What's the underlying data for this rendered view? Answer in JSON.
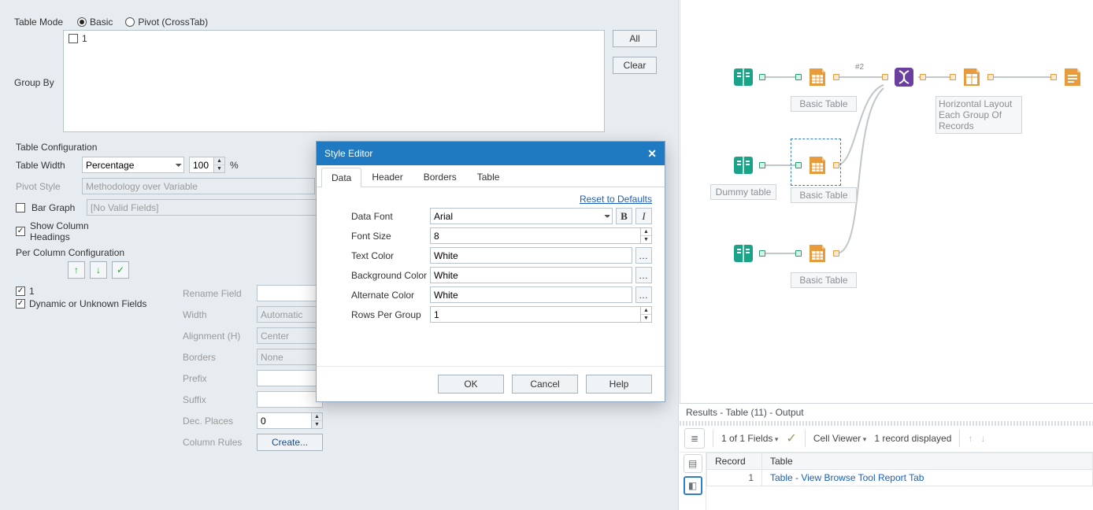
{
  "left": {
    "tableMode": {
      "label": "Table Mode",
      "basic": "Basic",
      "pivot": "Pivot (CrossTab)",
      "selected": "basic"
    },
    "groupBy": {
      "label": "Group By",
      "items": [
        "1"
      ]
    },
    "btn_all": "All",
    "btn_clear": "Clear",
    "sections": {
      "tc": "Table Configuration",
      "pcc": "Per Column Configuration"
    },
    "tc": {
      "tableWidth_lbl": "Table Width",
      "tableWidth_sel": "Percentage",
      "tableWidth_val": "100",
      "tableWidth_unit": "%",
      "pivotStyle_lbl": "Pivot Style",
      "pivotStyle_val": "Methodology over Variable",
      "barGraph_lbl": "Bar Graph",
      "barGraph_val": "[No Valid Fields]",
      "showHeadings_lbl": "Show Column Headings"
    },
    "pcc": {
      "list": [
        "1",
        "Dynamic or Unknown Fields"
      ],
      "rename_lbl": "Rename Field",
      "width_lbl": "Width",
      "width_val": "Automatic",
      "align_lbl": "Alignment (H)",
      "align_val": "Center",
      "borders_lbl": "Borders",
      "borders_val": "None",
      "prefix_lbl": "Prefix",
      "suffix_lbl": "Suffix",
      "dec_lbl": "Dec. Places",
      "dec_val": "0",
      "rules_lbl": "Column Rules",
      "create_btn": "Create..."
    }
  },
  "dialog": {
    "title": "Style Editor",
    "tabs": [
      "Data",
      "Header",
      "Borders",
      "Table"
    ],
    "active_tab": 0,
    "reset": "Reset to Defaults",
    "rows": {
      "dataFont_lbl": "Data Font",
      "dataFont_val": "Arial",
      "fontSize_lbl": "Font Size",
      "fontSize_val": "8",
      "textColor_lbl": "Text Color",
      "textColor_val": "White",
      "bgColor_lbl": "Background Color",
      "bgColor_val": "White",
      "altColor_lbl": "Alternate Color",
      "altColor_val": "White",
      "rowsPer_lbl": "Rows Per Group",
      "rowsPer_val": "1"
    },
    "buttons": {
      "ok": "OK",
      "cancel": "Cancel",
      "help": "Help"
    }
  },
  "canvas": {
    "nodes": {
      "a1_label": "Basic Table",
      "b1_label": "Horizontal Layout Each Group Of Records",
      "a2_inlabel": "Dummy table",
      "a2_label": "Basic Table",
      "a3_label": "Basic Table",
      "anchor_text": "#2"
    }
  },
  "results": {
    "title": "Results - Table (11) - Output",
    "fields": "1 of 1 Fields",
    "cellviewer": "Cell Viewer",
    "records": "1 record displayed",
    "headers": {
      "record": "Record",
      "table": "Table"
    },
    "rows": [
      {
        "n": "1",
        "table": "Table - View Browse Tool Report Tab"
      }
    ]
  }
}
